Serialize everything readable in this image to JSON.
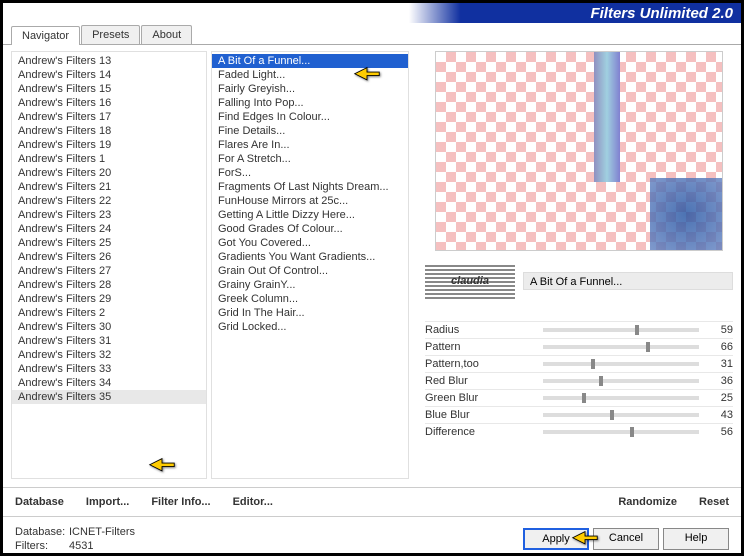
{
  "title": "Filters Unlimited 2.0",
  "tabs": [
    "Navigator",
    "Presets",
    "About"
  ],
  "activeTab": 0,
  "categories": [
    "Andrew's Filters 13",
    "Andrew's Filters 14",
    "Andrew's Filters 15",
    "Andrew's Filters 16",
    "Andrew's Filters 17",
    "Andrew's Filters 18",
    "Andrew's Filters 19",
    "Andrew's Filters 1",
    "Andrew's Filters 20",
    "Andrew's Filters 21",
    "Andrew's Filters 22",
    "Andrew's Filters 23",
    "Andrew's Filters 24",
    "Andrew's Filters 25",
    "Andrew's Filters 26",
    "Andrew's Filters 27",
    "Andrew's Filters 28",
    "Andrew's Filters 29",
    "Andrew's Filters 2",
    "Andrew's Filters 30",
    "Andrew's Filters 31",
    "Andrew's Filters 32",
    "Andrew's Filters 33",
    "Andrew's Filters 34",
    "Andrew's Filters 35"
  ],
  "highlightedCategoryIndex": 24,
  "filters": [
    "A Bit Of a Funnel...",
    "Faded Light...",
    "Fairly Greyish...",
    "Falling Into Pop...",
    "Find Edges In Colour...",
    "Fine Details...",
    "Flares Are In...",
    "For A Stretch...",
    "ForS...",
    "Fragments Of Last Nights Dream...",
    "FunHouse Mirrors at 25c...",
    "Getting A Little Dizzy Here...",
    "Good Grades Of Colour...",
    "Got You Covered...",
    "Gradients You Want Gradients...",
    "Grain Out Of Control...",
    "Grainy GrainY...",
    "Greek Column...",
    "Grid In The Hair...",
    "Grid Locked..."
  ],
  "selectedFilterIndex": 0,
  "currentFilterName": "A Bit Of a Funnel...",
  "watermark": "claudia",
  "params": [
    {
      "label": "Radius",
      "value": 59
    },
    {
      "label": "Pattern",
      "value": 66
    },
    {
      "label": "Pattern,too",
      "value": 31
    },
    {
      "label": "Red Blur",
      "value": 36
    },
    {
      "label": "Green Blur",
      "value": 25
    },
    {
      "label": "Blue Blur",
      "value": 43
    },
    {
      "label": "Difference",
      "value": 56
    }
  ],
  "toolbar": {
    "database": "Database",
    "import": "Import...",
    "filterInfo": "Filter Info...",
    "editor": "Editor...",
    "randomize": "Randomize",
    "reset": "Reset"
  },
  "info": {
    "databaseLabel": "Database:",
    "databaseValue": "ICNET-Filters",
    "filtersLabel": "Filters:",
    "filtersValue": "4531"
  },
  "buttons": {
    "apply": "Apply",
    "cancel": "Cancel",
    "help": "Help"
  }
}
